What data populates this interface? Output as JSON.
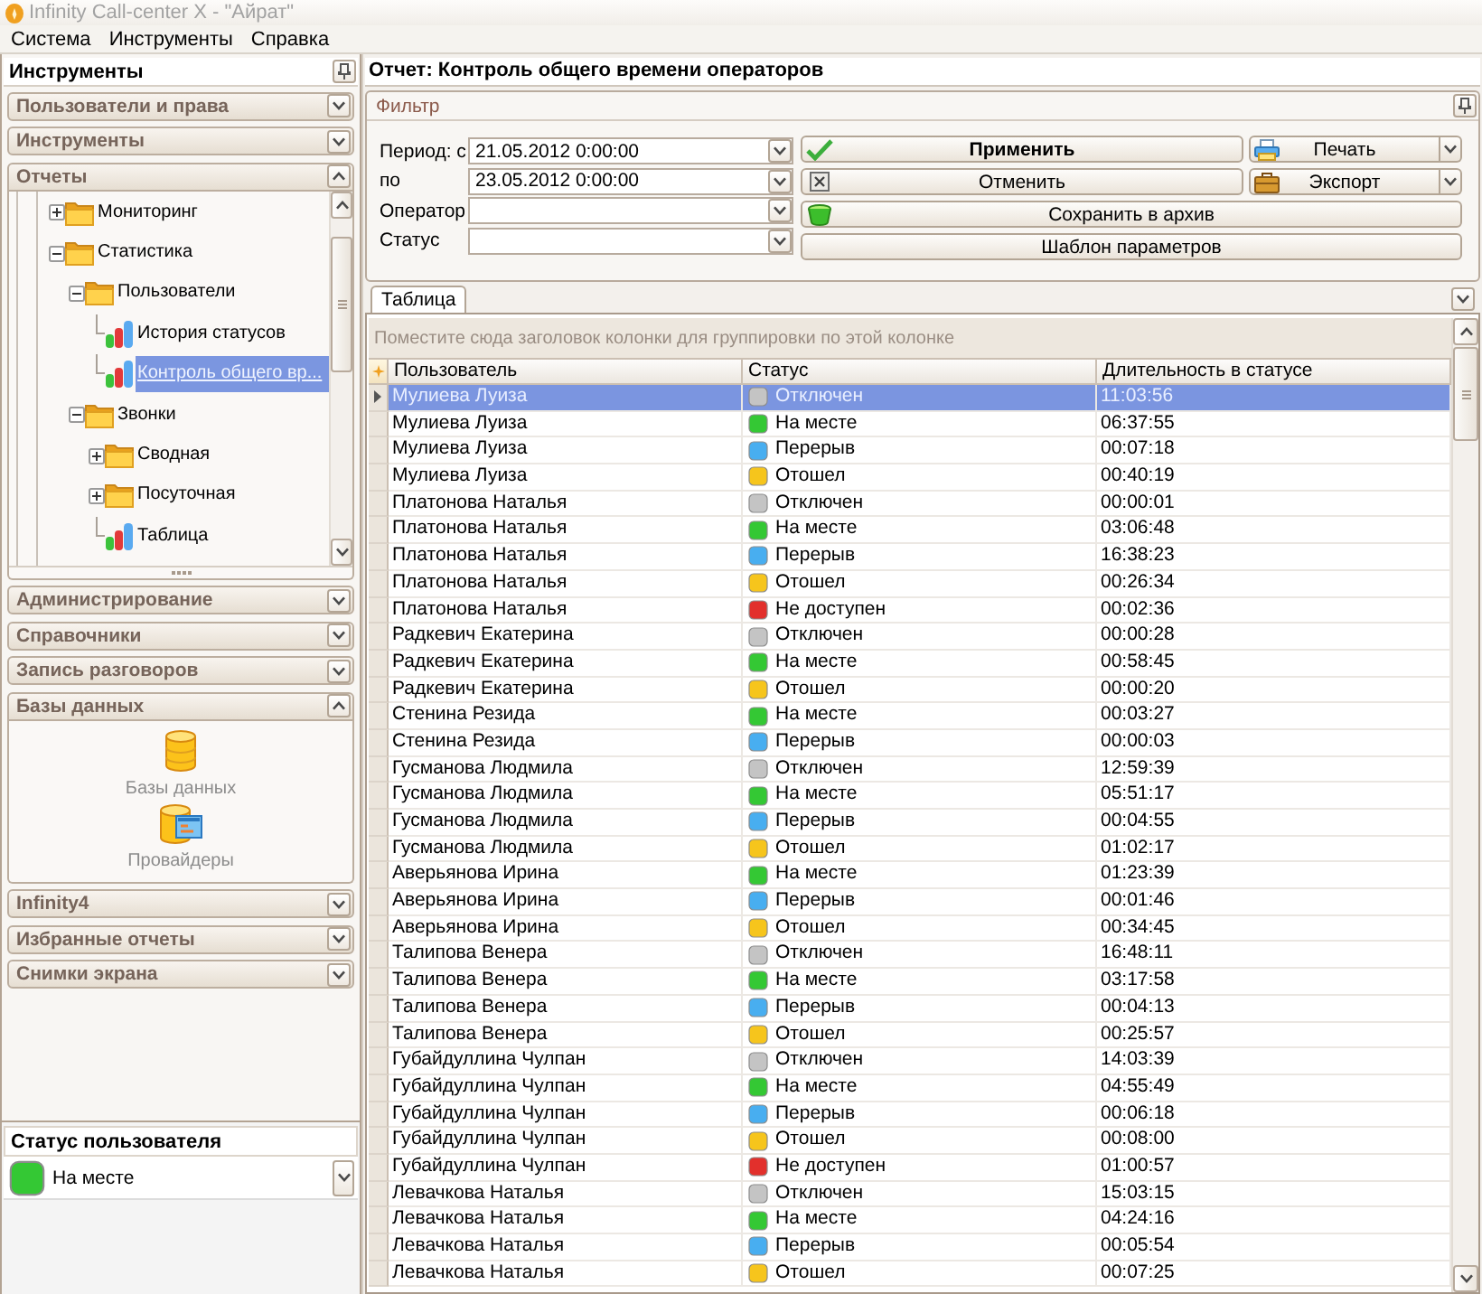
{
  "window": {
    "title": "Infinity Call-center X - \"Айрат\""
  },
  "menu": [
    "Система",
    "Инструменты",
    "Справка"
  ],
  "sidebar": {
    "title": "Инструменты",
    "sections": [
      {
        "label": "Пользователи и права",
        "expanded": false
      },
      {
        "label": "Инструменты",
        "expanded": false
      },
      {
        "label": "Отчеты",
        "expanded": true,
        "kind": "tree",
        "tree": [
          {
            "label": "Мониторинг",
            "kind": "folder",
            "expanded": false,
            "selected": false
          },
          {
            "label": "Статистика",
            "kind": "folder",
            "expanded": true,
            "selected": false,
            "children": [
              {
                "label": "Пользователи",
                "kind": "folder",
                "expanded": true,
                "selected": false,
                "children": [
                  {
                    "label": "История статусов",
                    "kind": "report",
                    "selected": false
                  },
                  {
                    "label": "Контроль общего вр...",
                    "kind": "report",
                    "selected": true
                  }
                ]
              },
              {
                "label": "Звонки",
                "kind": "folder",
                "expanded": true,
                "selected": false,
                "children": [
                  {
                    "label": "Сводная",
                    "kind": "folder",
                    "expanded": false,
                    "selected": false
                  },
                  {
                    "label": "Посуточная",
                    "kind": "folder",
                    "expanded": false,
                    "selected": false
                  },
                  {
                    "label": "Таблица",
                    "kind": "report",
                    "selected": false
                  }
                ]
              }
            ]
          }
        ]
      },
      {
        "label": "Администрирование",
        "expanded": false
      },
      {
        "label": "Справочники",
        "expanded": false
      },
      {
        "label": "Запись разговоров",
        "expanded": false
      },
      {
        "label": "Базы данных",
        "expanded": true,
        "kind": "icons",
        "items": [
          {
            "label": "Базы данных",
            "kind": "database"
          },
          {
            "label": "Провайдеры",
            "kind": "providers"
          }
        ]
      },
      {
        "label": "Infinity4",
        "expanded": false
      },
      {
        "label": "Избранные отчеты",
        "expanded": false
      },
      {
        "label": "Снимки экрана",
        "expanded": false
      }
    ]
  },
  "user_status": {
    "title": "Статус пользователя",
    "value": "На месте"
  },
  "report": {
    "title": "Отчет: Контроль общего времени операторов",
    "filter": {
      "title": "Фильтр",
      "fields": [
        {
          "label": "Период: с",
          "value": "21.05.2012 0:00:00"
        },
        {
          "label": "по",
          "value": "23.05.2012 0:00:00"
        },
        {
          "label": "Оператор"
        },
        {
          "label": "Статус"
        }
      ],
      "buttons": [
        {
          "label": "Применить",
          "kind": "apply"
        },
        {
          "label": "Печать",
          "kind": "print"
        },
        {
          "label": "Отменить",
          "kind": "cancel"
        },
        {
          "label": "Экспорт",
          "kind": "export"
        },
        {
          "label": "Сохранить в архив",
          "kind": "archive"
        },
        {
          "label": "Шаблон параметров",
          "kind": "template"
        }
      ]
    },
    "tabs": [
      {
        "label": "Таблица",
        "selected": true
      }
    ],
    "table": {
      "group_hint": "Поместите сюда заголовок колонки для группировки по этой колонке",
      "columns": [
        "Пользователь",
        "Статус",
        "Длительность в статусе"
      ],
      "rows": [
        {
          "user": "Мулиева Луиза",
          "status": "Отключен",
          "color": "#c4c4c4",
          "duration": "11:03:56",
          "selected": true
        },
        {
          "user": "Мулиева Луиза",
          "status": "На месте",
          "color": "#34c834",
          "duration": "06:37:55",
          "selected": false
        },
        {
          "user": "Мулиева Луиза",
          "status": "Перерыв",
          "color": "#48aef0",
          "duration": "00:07:18",
          "selected": false
        },
        {
          "user": "Мулиева Луиза",
          "status": "Отошел",
          "color": "#f6c51c",
          "duration": "00:40:19",
          "selected": false
        },
        {
          "user": "Платонова Наталья",
          "status": "Отключен",
          "color": "#c4c4c4",
          "duration": "00:00:01",
          "selected": false
        },
        {
          "user": "Платонова Наталья",
          "status": "На месте",
          "color": "#34c834",
          "duration": "03:06:48",
          "selected": false
        },
        {
          "user": "Платонова Наталья",
          "status": "Перерыв",
          "color": "#48aef0",
          "duration": "16:38:23",
          "selected": false
        },
        {
          "user": "Платонова Наталья",
          "status": "Отошел",
          "color": "#f6c51c",
          "duration": "00:26:34",
          "selected": false
        },
        {
          "user": "Платонова Наталья",
          "status": "Не доступен",
          "color": "#e2302c",
          "duration": "00:02:36",
          "selected": false
        },
        {
          "user": "Радкевич Екатерина",
          "status": "Отключен",
          "color": "#c4c4c4",
          "duration": "00:00:28",
          "selected": false
        },
        {
          "user": "Радкевич Екатерина",
          "status": "На месте",
          "color": "#34c834",
          "duration": "00:58:45",
          "selected": false
        },
        {
          "user": "Радкевич Екатерина",
          "status": "Отошел",
          "color": "#f6c51c",
          "duration": "00:00:20",
          "selected": false
        },
        {
          "user": "Стенина Резида",
          "status": "На месте",
          "color": "#34c834",
          "duration": "00:03:27",
          "selected": false
        },
        {
          "user": "Стенина Резида",
          "status": "Перерыв",
          "color": "#48aef0",
          "duration": "00:00:03",
          "selected": false
        },
        {
          "user": "Гусманова Людмила",
          "status": "Отключен",
          "color": "#c4c4c4",
          "duration": "12:59:39",
          "selected": false
        },
        {
          "user": "Гусманова Людмила",
          "status": "На месте",
          "color": "#34c834",
          "duration": "05:51:17",
          "selected": false
        },
        {
          "user": "Гусманова Людмила",
          "status": "Перерыв",
          "color": "#48aef0",
          "duration": "00:04:55",
          "selected": false
        },
        {
          "user": "Гусманова Людмила",
          "status": "Отошел",
          "color": "#f6c51c",
          "duration": "01:02:17",
          "selected": false
        },
        {
          "user": "Аверьянова Ирина",
          "status": "На месте",
          "color": "#34c834",
          "duration": "01:23:39",
          "selected": false
        },
        {
          "user": "Аверьянова Ирина",
          "status": "Перерыв",
          "color": "#48aef0",
          "duration": "00:01:46",
          "selected": false
        },
        {
          "user": "Аверьянова Ирина",
          "status": "Отошел",
          "color": "#f6c51c",
          "duration": "00:34:45",
          "selected": false
        },
        {
          "user": "Талипова Венера",
          "status": "Отключен",
          "color": "#c4c4c4",
          "duration": "16:48:11",
          "selected": false
        },
        {
          "user": "Талипова Венера",
          "status": "На месте",
          "color": "#34c834",
          "duration": "03:17:58",
          "selected": false
        },
        {
          "user": "Талипова Венера",
          "status": "Перерыв",
          "color": "#48aef0",
          "duration": "00:04:13",
          "selected": false
        },
        {
          "user": "Талипова Венера",
          "status": "Отошел",
          "color": "#f6c51c",
          "duration": "00:25:57",
          "selected": false
        },
        {
          "user": "Губайдуллина Чулпан",
          "status": "Отключен",
          "color": "#c4c4c4",
          "duration": "14:03:39",
          "selected": false
        },
        {
          "user": "Губайдуллина Чулпан",
          "status": "На месте",
          "color": "#34c834",
          "duration": "04:55:49",
          "selected": false
        },
        {
          "user": "Губайдуллина Чулпан",
          "status": "Перерыв",
          "color": "#48aef0",
          "duration": "00:06:18",
          "selected": false
        },
        {
          "user": "Губайдуллина Чулпан",
          "status": "Отошел",
          "color": "#f6c51c",
          "duration": "00:08:00",
          "selected": false
        },
        {
          "user": "Губайдуллина Чулпан",
          "status": "Не доступен",
          "color": "#e2302c",
          "duration": "01:00:57",
          "selected": false
        },
        {
          "user": "Левачкова Наталья",
          "status": "Отключен",
          "color": "#c4c4c4",
          "duration": "15:03:15",
          "selected": false
        },
        {
          "user": "Левачкова Наталья",
          "status": "На месте",
          "color": "#34c834",
          "duration": "04:24:16",
          "selected": false
        },
        {
          "user": "Левачкова Наталья",
          "status": "Перерыв",
          "color": "#48aef0",
          "duration": "00:05:54",
          "selected": false
        },
        {
          "user": "Левачкова Наталья",
          "status": "Отошел",
          "color": "#f6c51c",
          "duration": "00:07:25",
          "selected": false
        }
      ]
    }
  }
}
